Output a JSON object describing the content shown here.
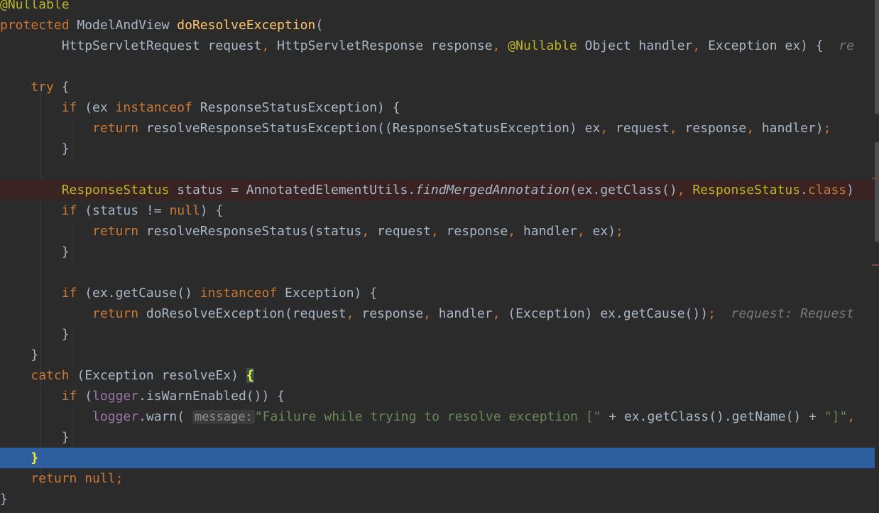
{
  "editor": {
    "colors": {
      "background": "#2b2b2b",
      "default_text": "#a9b7c6",
      "keyword": "#cc7832",
      "annotation": "#bbb529",
      "function_decl": "#ffc66d",
      "field": "#9876aa",
      "string": "#6a8759",
      "selection": "#2d5e9e"
    },
    "lines": [
      "@Nullable",
      "protected ModelAndView doResolveException(",
      "        HttpServletRequest request, HttpServletResponse response, @Nullable Object handler, Exception ex) {",
      "",
      "    try {",
      "        if (ex instanceof ResponseStatusException) {",
      "            return resolveResponseStatusException((ResponseStatusException) ex, request, response, handler);",
      "        }",
      "",
      "        ResponseStatus status = AnnotatedElementUtils.findMergedAnnotation(ex.getClass(), ResponseStatus.class)",
      "        if (status != null) {",
      "            return resolveResponseStatus(status, request, response, handler, ex);",
      "        }",
      "",
      "        if (ex.getCause() instanceof Exception) {",
      "            return doResolveException(request, response, handler, (Exception) ex.getCause());",
      "        }",
      "    }",
      "    catch (Exception resolveEx) {",
      "        if (logger.isWarnEnabled()) {",
      "            logger.warn(\"Failure while trying to resolve exception [\" + ex.getClass().getName() + \"]\",",
      "        }",
      "    }",
      "    return null;",
      "}"
    ],
    "inlay_hints": {
      "line_3": "re",
      "line_16": "request: Request",
      "line_21_param": "message:"
    },
    "watermark_top": "",
    "watermark_bottom": ""
  }
}
